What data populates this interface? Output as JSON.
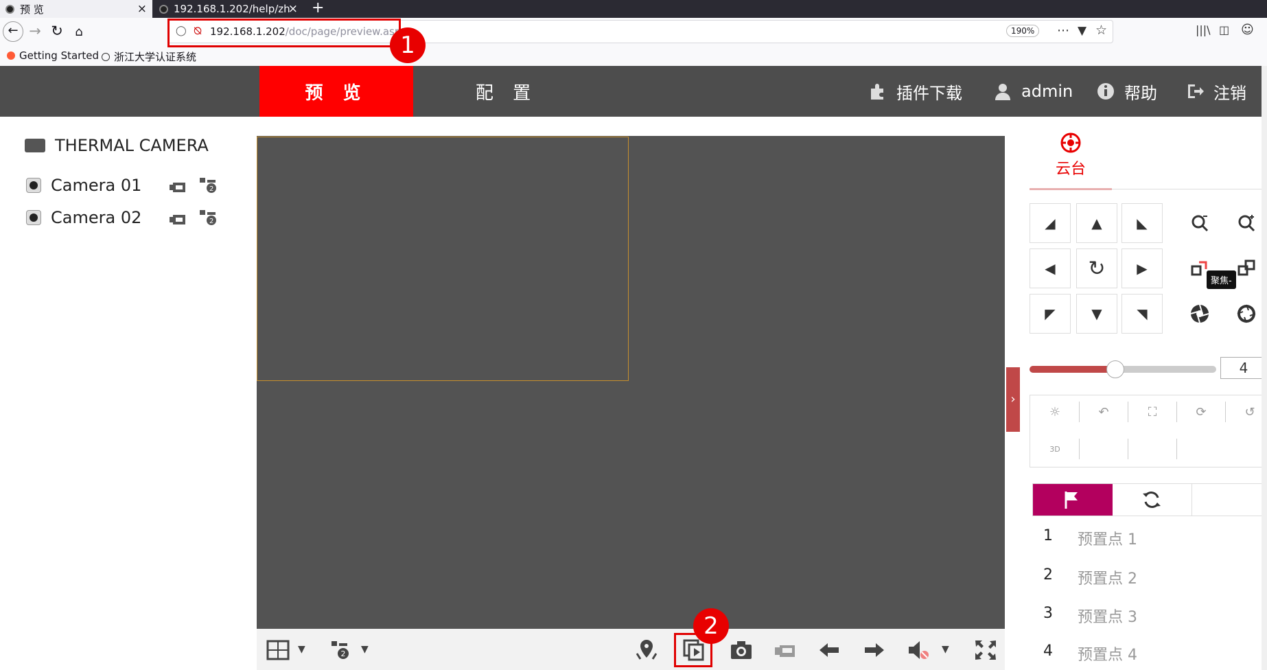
{
  "browser": {
    "tabs": [
      {
        "label": "预 览",
        "close": "×"
      },
      {
        "label": "192.168.1.202/help/zh",
        "close": "×"
      }
    ],
    "new_tab": "+",
    "url_host": "192.168.1.202",
    "url_path": "/doc/page/preview.asp",
    "zoom": "190%",
    "bookmarks": [
      "Getting Started",
      "浙江大学认证系统"
    ]
  },
  "annotations": {
    "one": "1",
    "two": "2"
  },
  "header": {
    "tabs": {
      "preview": "预 览",
      "config": "配 置"
    },
    "plugin": "插件下载",
    "user": "admin",
    "help": "帮助",
    "logout": "注销"
  },
  "devices": {
    "group": "THERMAL CAMERA",
    "cameras": [
      "Camera 01",
      "Camera 02"
    ]
  },
  "ptz": {
    "title": "云台",
    "tooltip": "聚焦-",
    "speed": "4",
    "speed_level": 0.46,
    "func_3d": "3D",
    "presets": [
      {
        "num": "1",
        "label": "预置点 1"
      },
      {
        "num": "2",
        "label": "预置点 2"
      },
      {
        "num": "3",
        "label": "预置点 3"
      },
      {
        "num": "4",
        "label": "预置点 4"
      }
    ]
  },
  "colors": {
    "accent": "#ff0000",
    "header_bg": "#4d4d4d",
    "video_bg": "#535353",
    "preset_tab": "#b3005e"
  }
}
